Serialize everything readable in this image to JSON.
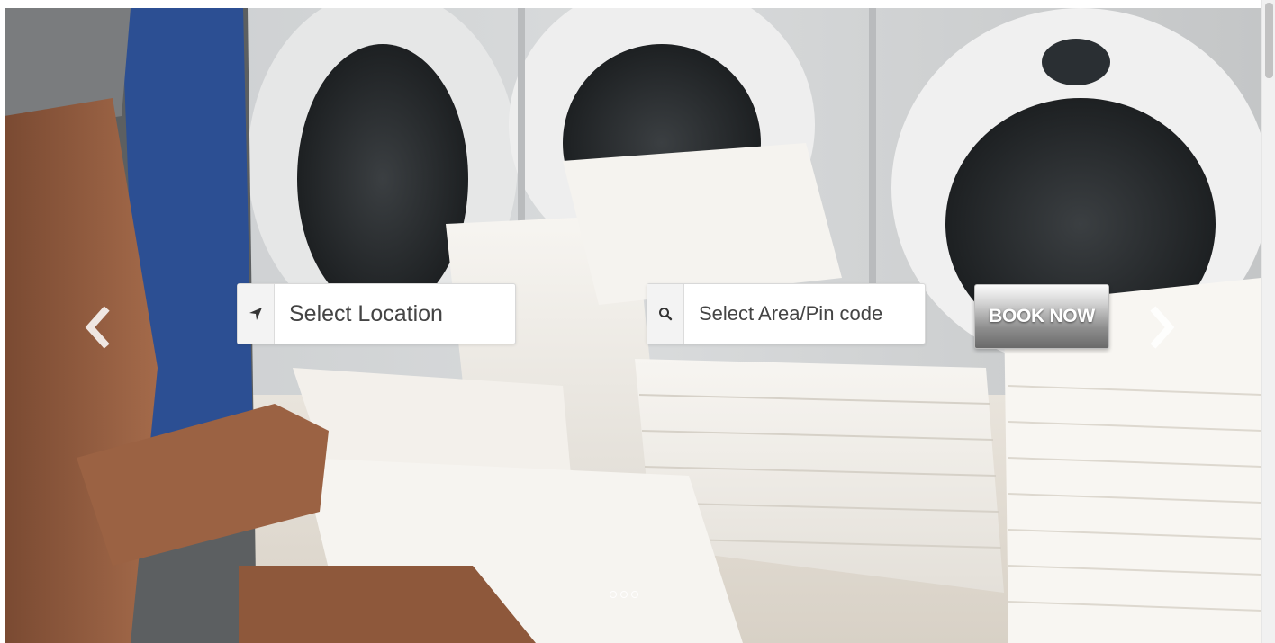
{
  "hero": {
    "image_icon": "laundry-towels-photo"
  },
  "carousel": {
    "prev_icon": "chevron-left-icon",
    "next_icon": "chevron-right-icon",
    "slide_count": 3,
    "active_slide": 1
  },
  "search": {
    "location": {
      "icon": "location-arrow-icon",
      "placeholder": "Select Location"
    },
    "area": {
      "icon": "search-icon",
      "placeholder": "Select Area/Pin code"
    },
    "book_label": "BOOK NOW"
  },
  "colors": {
    "button_text": "#ffffff",
    "field_text": "#444444",
    "addon_bg": "#f3f3f3"
  }
}
